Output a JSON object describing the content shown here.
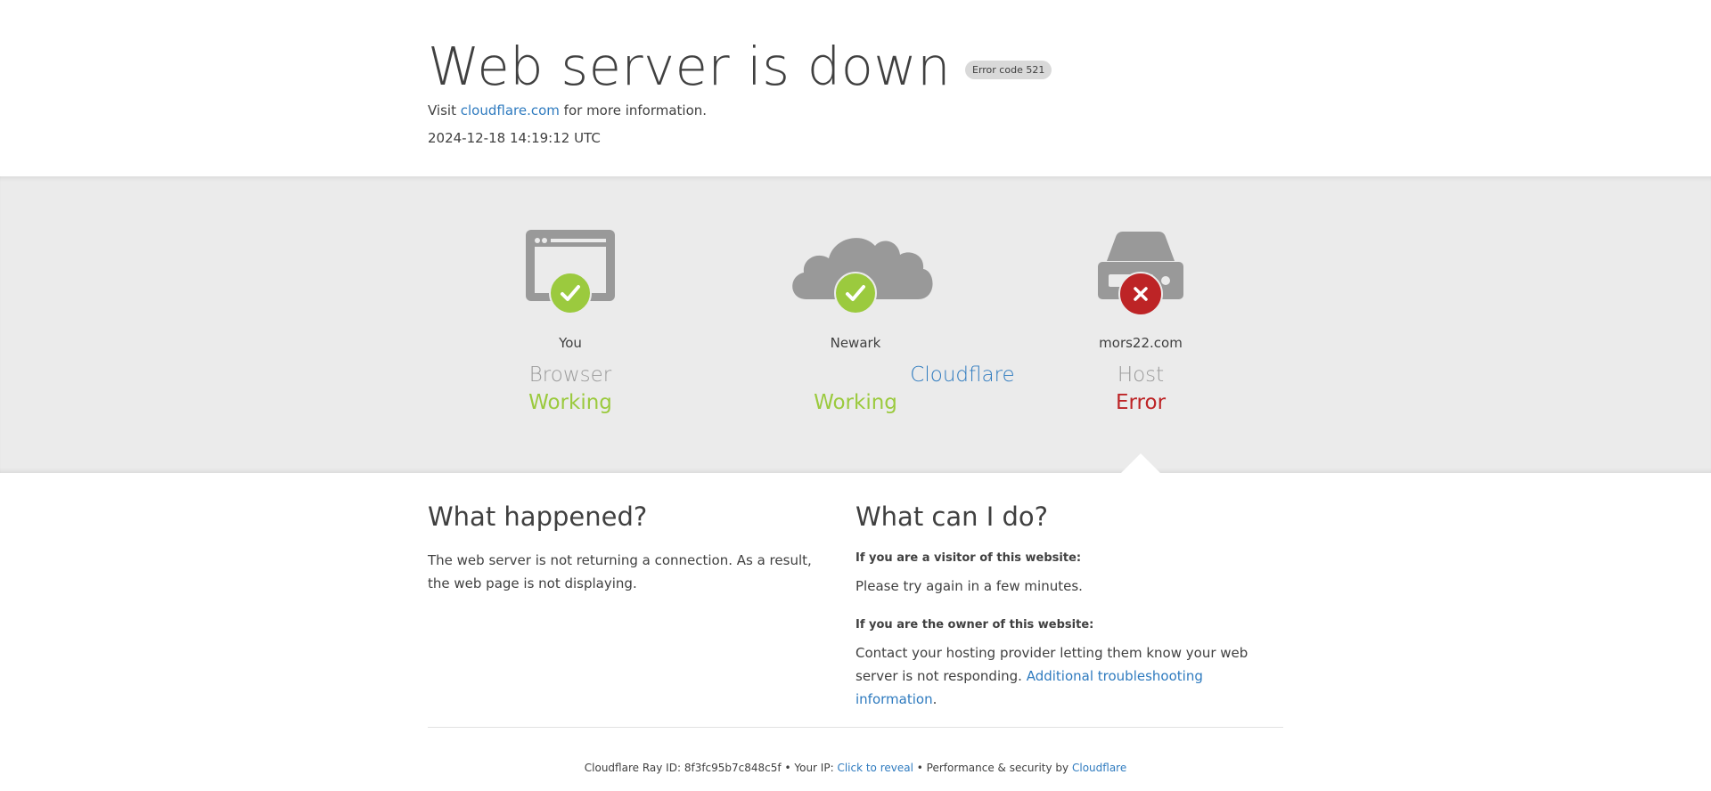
{
  "header": {
    "title": "Web server is down",
    "error_code": "Error code 521",
    "visit_prefix": "Visit",
    "visit_link": "cloudflare.com",
    "visit_suffix": "for more information.",
    "timestamp": "2024-12-18 14:19:12 UTC"
  },
  "status": [
    {
      "location": "You",
      "kind": "Browser",
      "state": "Working",
      "icon": "browser-icon",
      "badge": "check-icon"
    },
    {
      "location": "Newark",
      "kind": "Cloudflare",
      "state": "Working",
      "icon": "cloud-icon",
      "badge": "check-icon"
    },
    {
      "location": "mors22.com",
      "kind": "Host",
      "state": "Error",
      "icon": "server-icon",
      "badge": "x-icon"
    }
  ],
  "colors": {
    "ok": "#9bca3e",
    "error": "#bd2426",
    "link": "#2f7bbf",
    "icon_gray": "#999999",
    "band_bg": "#ebebeb"
  },
  "what_happened": {
    "heading": "What happened?",
    "body": "The web server is not returning a connection. As a result, the web page is not displaying."
  },
  "what_can_i_do": {
    "heading": "What can I do?",
    "visitor_heading": "If you are a visitor of this website:",
    "visitor_body": "Please try again in a few minutes.",
    "owner_heading": "If you are the owner of this website:",
    "owner_body": "Contact your hosting provider letting them know your web server is not responding.",
    "owner_link": "Additional troubleshooting information",
    "owner_link_suffix": "."
  },
  "footer": {
    "ray_label": "Cloudflare Ray ID:",
    "ray_id": "8f3fc95b7c848c5f",
    "sep1": "•",
    "ip_label": "Your IP:",
    "ip_link": "Click to reveal",
    "sep2": "•",
    "perf_label": "Performance & security by",
    "perf_link": "Cloudflare"
  }
}
